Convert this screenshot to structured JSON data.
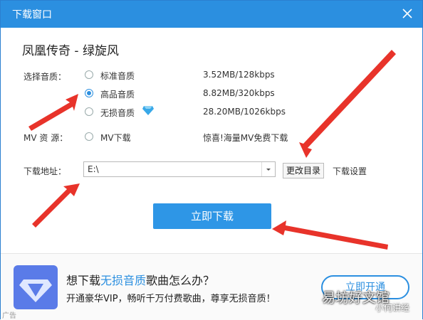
{
  "window": {
    "title": "下载窗口"
  },
  "song": {
    "title": "凤凰传奇 - 绿旋风"
  },
  "quality": {
    "label": "选择音质：",
    "options": [
      {
        "label": "标准音质",
        "size": "3.52MB/128kbps",
        "selected": false
      },
      {
        "label": "高品音质",
        "size": "8.82MB/320kbps",
        "selected": true
      },
      {
        "label": "无损音质",
        "size": "28.20MB/1026kbps",
        "selected": false,
        "icon": "diamond-icon"
      }
    ]
  },
  "mv": {
    "label": "MV 资 源：",
    "option": "MV下载",
    "note": "惊喜!海量MV免费下载"
  },
  "path": {
    "label": "下载地址：",
    "value": "E:\\",
    "change_button": "更改目录",
    "settings_link": "下载设置"
  },
  "download_button": "立即下载",
  "promo": {
    "title_prefix": "想下载",
    "title_highlight": "无损音质",
    "title_suffix": "歌曲怎么办？",
    "subtitle": "开通豪华VIP，畅听千万付费歌曲，尊享无损音质！",
    "button": "立即开通",
    "ad_label": "广告"
  },
  "watermark": {
    "main": "易坊好文馆",
    "sub": "小何讲经"
  },
  "colors": {
    "accent": "#2b8fe0",
    "arrow": "#e8332a",
    "button": "#2e96e6"
  }
}
